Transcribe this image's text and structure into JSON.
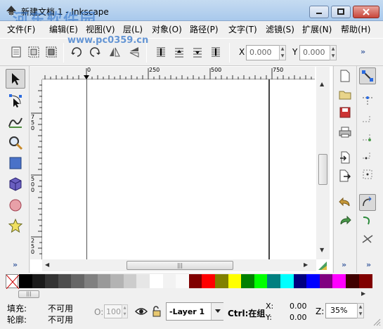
{
  "window": {
    "title": "新建文档 1 - Inkscape",
    "watermark": "河东软件园",
    "watermark_url": "www.pc0359.cn"
  },
  "menu": [
    {
      "label": "文件(F)"
    },
    {
      "label": "编辑(E)"
    },
    {
      "label": "视图(V)"
    },
    {
      "label": "层(L)"
    },
    {
      "label": "对象(O)"
    },
    {
      "label": "路径(P)"
    },
    {
      "label": "文字(T)"
    },
    {
      "label": "滤镜(S)"
    },
    {
      "label": "扩展(N)"
    },
    {
      "label": "帮助(H)"
    }
  ],
  "toolbar": {
    "x_label": "X",
    "x_value": "0.000",
    "y_label": "Y",
    "y_value": "0.000",
    "more": "»"
  },
  "rulers": {
    "h_labels": [
      "0",
      "250",
      "500",
      "750"
    ],
    "v_labels": [
      "750",
      "500",
      "250"
    ]
  },
  "left_more": "»",
  "right_more": "»",
  "right2_more": "»",
  "colors": {
    "palette": [
      "#000000",
      "#1a1a1a",
      "#333333",
      "#4d4d4d",
      "#666666",
      "#808080",
      "#999999",
      "#b3b3b3",
      "#cccccc",
      "#e6e6e6",
      "#ffffff",
      "#f2f2f2",
      "#fafafa",
      "#800000",
      "#ff0000",
      "#808000",
      "#ffff00",
      "#008000",
      "#00ff00",
      "#008080",
      "#00ffff",
      "#000080",
      "#0000ff",
      "#800080",
      "#ff00ff",
      "#400000",
      "#800000"
    ]
  },
  "status": {
    "fill_label": "填充:",
    "fill_value": "不可用",
    "stroke_label": "轮廓:",
    "stroke_value": "不可用",
    "opacity_label": "O:",
    "opacity_value": "100",
    "layer_value": "-Layer 1",
    "hint": "Ctrl:在组",
    "x_label": "X:",
    "x_value": "0.00",
    "y_label": "Y:",
    "y_value": "0.00",
    "zoom_label": "Z:",
    "zoom_value": "35%"
  }
}
